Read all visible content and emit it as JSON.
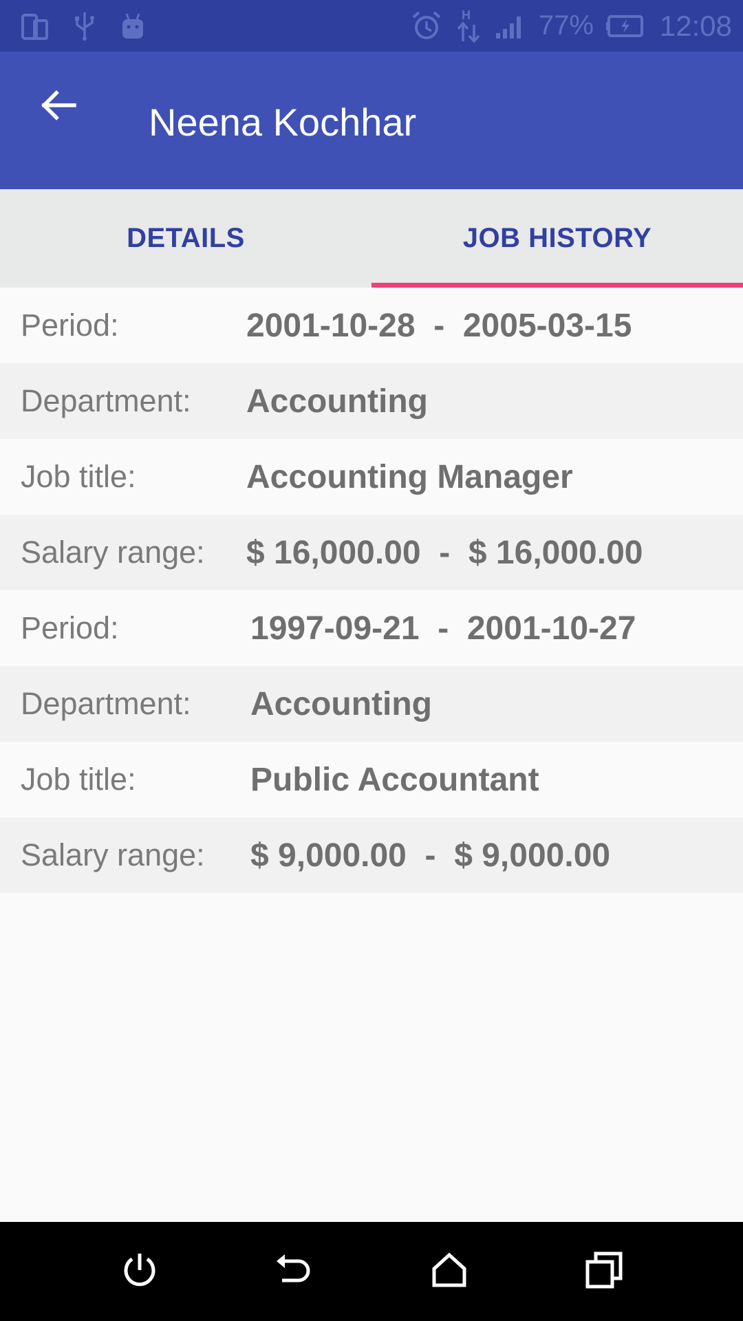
{
  "status_bar": {
    "battery_percent": "77%",
    "time": "12:08",
    "network_type": "H",
    "icons": [
      "screen-rotation-icon",
      "usb-icon",
      "android-debug-icon",
      "alarm-icon",
      "data-transfer-icon",
      "signal-icon",
      "battery-charging-icon"
    ]
  },
  "app_bar": {
    "title": "Neena Kochhar",
    "back_icon": "arrow-left-icon"
  },
  "tabs": [
    {
      "label": "DETAILS",
      "selected": false
    },
    {
      "label": "JOB HISTORY",
      "selected": true
    }
  ],
  "job_history": [
    {
      "period_label": "Period:",
      "period_value": "2001-10-28  -  2005-03-15",
      "department_label": "Department:",
      "department_value": "Accounting",
      "job_title_label": "Job title:",
      "job_title_value": "Accounting Manager",
      "salary_label": "Salary range:",
      "salary_value": "$ 16,000.00  -  $ 16,000.00"
    },
    {
      "period_label": "Period:",
      "period_value": "1997-09-21  -  2001-10-27",
      "department_label": "Department:",
      "department_value": "Accounting",
      "job_title_label": "Job title:",
      "job_title_value": "Public Accountant",
      "salary_label": "Salary range:",
      "salary_value": "$ 9,000.00  -  $ 9,000.00"
    }
  ],
  "nav_bar": {
    "icons": [
      "power-icon",
      "back-icon",
      "home-icon",
      "recents-icon"
    ]
  },
  "colors": {
    "status_bar": "#2f3f9e",
    "app_bar": "#3f51b5",
    "tab_text": "#3140a0",
    "tab_indicator": "#f0407c"
  }
}
